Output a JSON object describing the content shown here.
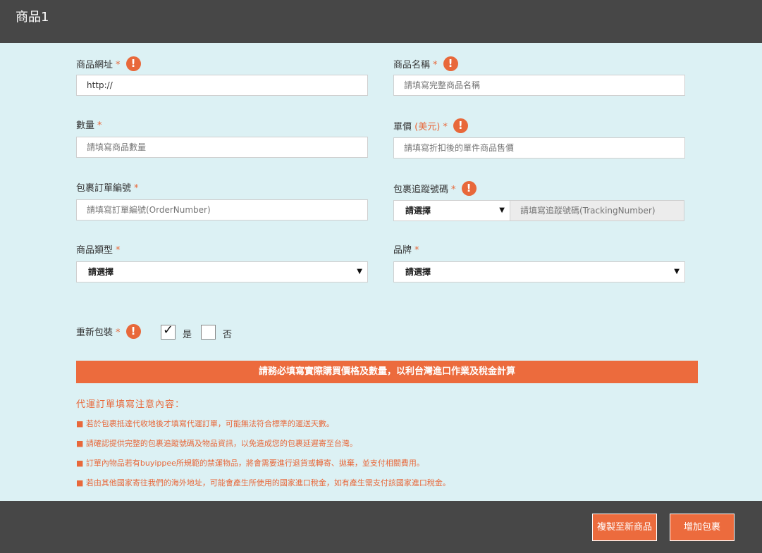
{
  "header": {
    "title": "商品1"
  },
  "fields": {
    "url": {
      "label": "商品網址",
      "value": "http://"
    },
    "name": {
      "label": "商品名稱",
      "placeholder": "請填寫完整商品名稱"
    },
    "quantity": {
      "label": "數量",
      "placeholder": "請填寫商品數量"
    },
    "price": {
      "label": "單價",
      "currency": "(美元)",
      "placeholder": "請填寫折扣後的單件商品售價"
    },
    "order_number": {
      "label": "包裹訂單編號",
      "placeholder": "請填寫訂單編號(OrderNumber)"
    },
    "tracking": {
      "label": "包裹追蹤號碼",
      "select_value": "請選擇",
      "placeholder": "請填寫追蹤號碼(TrackingNumber)"
    },
    "category": {
      "label": "商品類型",
      "value": "請選擇"
    },
    "brand": {
      "label": "品牌",
      "value": "請選擇"
    },
    "repack": {
      "label": "重新包裝",
      "yes": "是",
      "no": "否",
      "yes_checked": true,
      "no_checked": false
    }
  },
  "required_mark": "*",
  "warn_symbol": "!",
  "notice": "請務必填寫實際購買價格及數量，以利台灣進口作業及稅金計算",
  "notes": {
    "title": "代運訂單填寫注意內容：",
    "items": [
      "■ 若於包裹抵達代收地後才填寫代運訂單，可能無法符合標準的運送天數。",
      "■ 請確認提供完整的包裹追蹤號碼及物品資訊，以免造成您的包裹延遲寄至台灣。",
      "■ 訂單內物品若有buyippee所規範的禁運物品，將會需要進行退貨或轉寄、拋棄，並支付相關費用。",
      "■ 若由其他國家寄往我們的海外地址，可能會產生所使用的國家進口稅金，如有產生需支付該國家進口稅金。"
    ]
  },
  "buttons": {
    "copy": "複製至新商品",
    "add": "增加包裹"
  },
  "colors": {
    "accent": "#ec6b3d",
    "bar": "#474747",
    "background": "#dcf1f4"
  }
}
